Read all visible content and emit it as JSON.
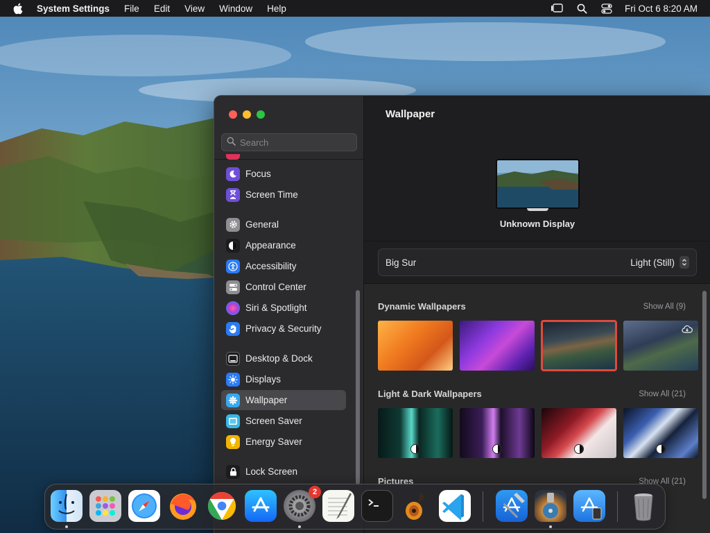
{
  "menubar": {
    "app_name": "System Settings",
    "menus": [
      "File",
      "Edit",
      "View",
      "Window",
      "Help"
    ],
    "datetime": "Fri Oct 6  8:20 AM",
    "status_icons": [
      "stage-manager-icon",
      "search-icon",
      "control-center-icon"
    ]
  },
  "window": {
    "search_placeholder": "Search",
    "sidebar": [
      {
        "label": "Focus",
        "icon": "focus-moon-icon",
        "color": "#6e4fd8"
      },
      {
        "label": "Screen Time",
        "icon": "hourglass-icon",
        "color": "#6e4fd8"
      },
      {
        "label": "General",
        "icon": "gear-icon",
        "color": "#8e8e93"
      },
      {
        "label": "Appearance",
        "icon": "appearance-icon",
        "color": "#1c1c1e"
      },
      {
        "label": "Accessibility",
        "icon": "accessibility-icon",
        "color": "#2a7bf6"
      },
      {
        "label": "Control Center",
        "icon": "control-center-icon",
        "color": "#8e8e93"
      },
      {
        "label": "Siri & Spotlight",
        "icon": "siri-icon",
        "color": "#c13fd8"
      },
      {
        "label": "Privacy & Security",
        "icon": "hand-icon",
        "color": "#2a7bf6"
      },
      {
        "label": "Desktop & Dock",
        "icon": "dock-icon",
        "color": "#1c1c1e"
      },
      {
        "label": "Displays",
        "icon": "sun-icon",
        "color": "#2a7bf6"
      },
      {
        "label": "Wallpaper",
        "icon": "wallpaper-icon",
        "color": "#37a9f0",
        "selected": true
      },
      {
        "label": "Screen Saver",
        "icon": "screen-saver-icon",
        "color": "#37b9e6"
      },
      {
        "label": "Energy Saver",
        "icon": "energy-bulb-icon",
        "color": "#f2b400"
      },
      {
        "label": "Lock Screen",
        "icon": "lock-icon",
        "color": "#1c1c1e"
      }
    ],
    "content": {
      "title": "Wallpaper",
      "display_name": "Unknown Display",
      "picker_name": "Big Sur",
      "picker_value": "Light (Still)",
      "sections": [
        {
          "title": "Dynamic Wallpapers",
          "show_all": "Show All (9)"
        },
        {
          "title": "Light & Dark Wallpapers",
          "show_all": "Show All (21)"
        },
        {
          "title": "Pictures",
          "show_all": "Show All (21)"
        }
      ]
    }
  },
  "dock": {
    "apps": [
      "Finder",
      "Launchpad",
      "Safari",
      "Firefox",
      "Chrome",
      "App Store",
      "System Settings",
      "TextEdit",
      "Terminal",
      "GarageBand",
      "Visual Studio Code",
      "Xcode",
      "Disk Utility",
      "Simulator",
      "Trash"
    ],
    "settings_badge": "2"
  }
}
